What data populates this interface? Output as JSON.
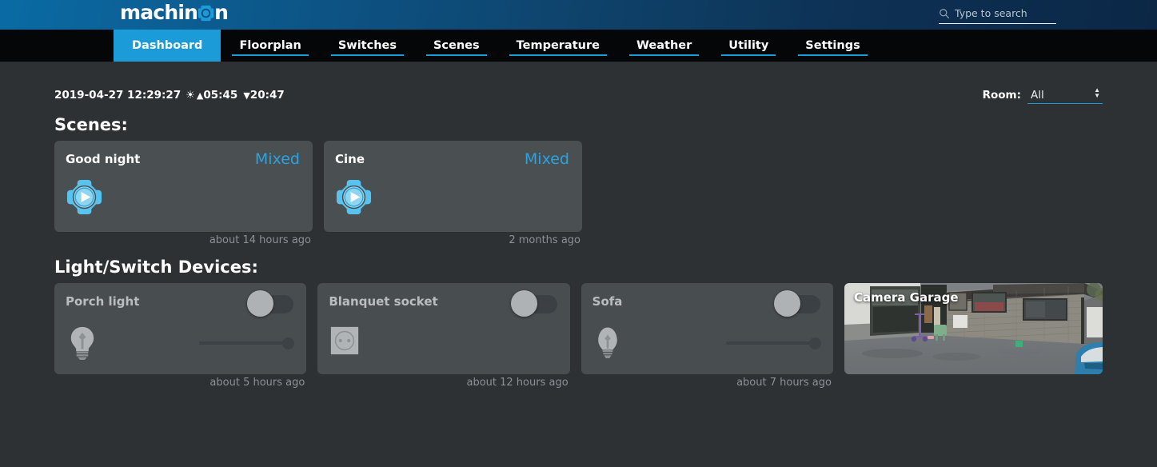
{
  "header": {
    "logo_text_left": "machin",
    "logo_text_right": "n",
    "logo_gear_icon": "gear-icon",
    "search": {
      "icon": "search-icon",
      "placeholder": "Type to search",
      "value": ""
    }
  },
  "nav": {
    "items": [
      {
        "label": "Dashboard",
        "active": true
      },
      {
        "label": "Floorplan",
        "active": false
      },
      {
        "label": "Switches",
        "active": false
      },
      {
        "label": "Scenes",
        "active": false
      },
      {
        "label": "Temperature",
        "active": false
      },
      {
        "label": "Weather",
        "active": false
      },
      {
        "label": "Utility",
        "active": false
      },
      {
        "label": "Settings",
        "active": false
      }
    ],
    "active_color": "#1b9bd8"
  },
  "status": {
    "datetime": "2019-04-27 12:29:27",
    "sun_icon": "sun-icon",
    "sunrise_icon": "triangle-up-icon",
    "sunrise": "05:45",
    "sunset_icon": "triangle-down-icon",
    "sunset": "20:47"
  },
  "room_filter": {
    "label": "Room:",
    "value": "All",
    "options": [
      "All"
    ]
  },
  "scenes_section": {
    "title": "Scenes:",
    "cards": [
      {
        "name": "Good night",
        "state": "Mixed",
        "icon": "scene-play-gear-icon",
        "timestamp": "about 14 hours ago"
      },
      {
        "name": "Cine",
        "state": "Mixed",
        "icon": "scene-play-gear-icon",
        "timestamp": "2 months ago"
      }
    ]
  },
  "devices_section": {
    "title": "Light/Switch Devices:",
    "cards": [
      {
        "name": "Porch light",
        "icon": "lightbulb-icon",
        "toggle_state": "off",
        "has_slider": true,
        "slider_percent": 88,
        "timestamp": "about 5 hours ago"
      },
      {
        "name": "Blanquet socket",
        "icon": "power-socket-icon",
        "toggle_state": "off",
        "has_slider": false,
        "slider_percent": 0,
        "timestamp": "about 12 hours ago"
      },
      {
        "name": "Sofa",
        "icon": "candle-bulb-icon",
        "toggle_state": "off",
        "has_slider": true,
        "slider_percent": 88,
        "timestamp": "about 7 hours ago"
      }
    ],
    "camera": {
      "label": "Camera Garage",
      "icon": "camera-feed"
    }
  },
  "colors": {
    "accent": "#1b9bd8",
    "state_text": "#2ba3e0",
    "page_bg": "#2e3133",
    "card_bg": "#4a4f52",
    "nav_bg": "#050607"
  }
}
